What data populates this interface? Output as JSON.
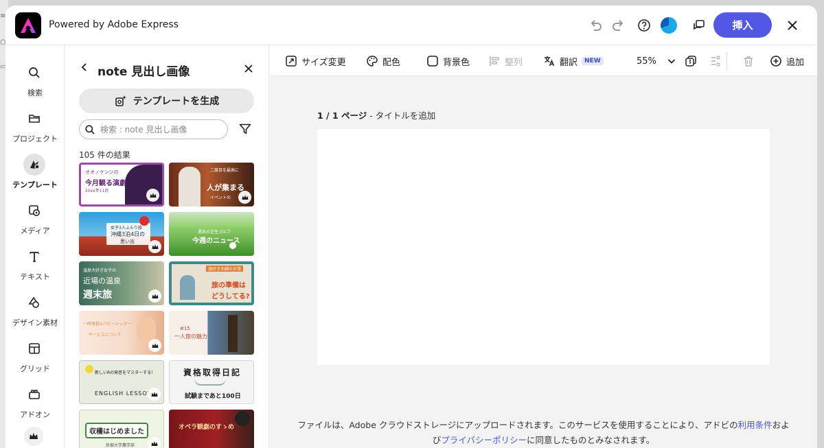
{
  "app": {
    "title": "Powered by Adobe Express"
  },
  "header": {
    "insert_label": "挿入"
  },
  "nav": {
    "items": [
      {
        "label": "検索",
        "icon": "search-icon"
      },
      {
        "label": "プロジェクト",
        "icon": "folder-icon"
      },
      {
        "label": "テンプレート",
        "icon": "templates-icon",
        "active": true
      },
      {
        "label": "メディア",
        "icon": "media-icon"
      },
      {
        "label": "テキスト",
        "icon": "text-icon"
      },
      {
        "label": "デザイン素材",
        "icon": "shapes-icon"
      },
      {
        "label": "グリッド",
        "icon": "grid-icon"
      },
      {
        "label": "アドオン",
        "icon": "addons-icon"
      }
    ]
  },
  "panel": {
    "title": "note 見出し画像",
    "generate_label": "テンプレートを生成",
    "search_placeholder": "検索 : note 見出し画像",
    "results_count": "105 件の結果",
    "thumbnails": [
      {
        "lines": [
          "オオノケンジの",
          "今月観る演劇",
          "20xx年11月"
        ]
      },
      {
        "lines": [
          "二度目を最高に",
          "人が集まる",
          "イベントの"
        ]
      },
      {
        "lines": [
          "女子3人ふらり旅",
          "沖縄3泊4日の",
          "思い出"
        ]
      },
      {
        "lines": [
          "週末の芝生ゴルフ",
          "今週のニュース"
        ]
      },
      {
        "lines": [
          "温泉大好き女子の",
          "近場の温泉",
          "週末旅"
        ]
      },
      {
        "lines": [
          "旅好き夫婦の日常",
          "旅の準備は",
          "どうしてる?"
        ]
      },
      {
        "lines": [
          "一時保育&ベビーシッター",
          "サービスについて"
        ]
      },
      {
        "lines": [
          "#15",
          "一人旅の魅力"
        ]
      },
      {
        "lines": [
          "新しいRの発音をマスターする!",
          "ENGLISH LESSON"
        ]
      },
      {
        "lines": [
          "資格取得日記",
          "試験まであと100日"
        ]
      },
      {
        "lines": [
          "収穫はじめました",
          "名樹大学農学部"
        ]
      },
      {
        "lines": [
          "オペラ観劇のすゝめ"
        ]
      }
    ]
  },
  "toolbar": {
    "resize": "サイズ変更",
    "color": "配色",
    "background": "背景色",
    "align": "整列",
    "translate": "翻訳",
    "new_badge": "NEW",
    "zoom": "55%",
    "add": "追加"
  },
  "canvas": {
    "page_count": "1 / 1 ページ",
    "page_title": " - タイトルを追加"
  },
  "footer": {
    "text1": "ファイルは、Adobe クラウドストレージにアップロードされます。このサービスを使用することにより、アドビの",
    "terms_link": "利用条件",
    "text2": "およ",
    "text3": "び",
    "privacy_link": "プライバシーポリシー",
    "text4": "に同意したものとみなされます。"
  },
  "colors": {
    "accent": "#5258e4",
    "link": "#4a57d8"
  }
}
